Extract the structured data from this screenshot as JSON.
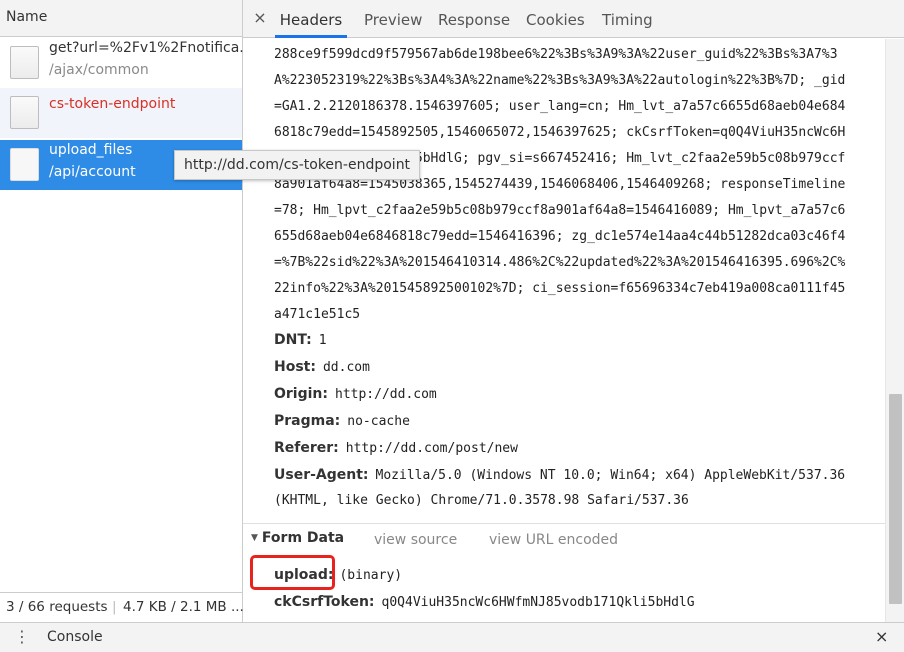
{
  "left": {
    "header": "Name",
    "requests": [
      {
        "name": "get?url=%2Fv1%2Fnotifica...",
        "path": "/ajax/common"
      },
      {
        "name": "cs-token-endpoint",
        "path": ""
      },
      {
        "name": "upload_files",
        "path": "/api/account"
      }
    ],
    "tooltip": "http://dd.com/cs-token-endpoint",
    "status": {
      "requests": "3 / 66 requests",
      "separator": "|",
      "size": "4.7 KB / 2.1 MB ..."
    }
  },
  "tabs": {
    "close": "×",
    "items": [
      "Headers",
      "Preview",
      "Response",
      "Cookies",
      "Timing"
    ],
    "active": "Headers"
  },
  "cookie_lines": [
    "288ce9f599dcd9f579567ab6de198bee6%22%3Bs%3A9%3A%22user_guid%22%3Bs%3A7%3",
    "A%223052319%22%3Bs%3A4%3A%22name%22%3Bs%3A9%3A%22autologin%22%3B%7D; _gid",
    "=GA1.2.2120186378.1546397605; user_lang=cn; Hm_lvt_a7a57c6655d68aeb04e684",
    "6818c79edd=1545892505,1546065072,1546397625; ckCsrfToken=q0Q4ViuH35ncWc6H",
    "WfmNJ85vodb171Qkli5bHdlG; pgv_si=s667452416; Hm_lvt_c2faa2e59b5c08b979ccf",
    "8a901af64a8=1545038365,1545274439,1546068406,1546409268; responseTimeline",
    "=78; Hm_lpvt_c2faa2e59b5c08b979ccf8a901af64a8=1546416089; Hm_lpvt_a7a57c6",
    "655d68aeb04e6846818c79edd=1546416396; zg_dc1e574e14aa4c44b51282dca03c46f4",
    "=%7B%22sid%22%3A%201546410314.486%2C%22updated%22%3A%201546416395.696%2C%",
    "22info%22%3A%201545892500102%7D; ci_session=f65696334c7eb419a008ca0111f45",
    "a471c1e51c5"
  ],
  "headers": {
    "dnt": {
      "key": "DNT:",
      "value": "1"
    },
    "host": {
      "key": "Host:",
      "value": "dd.com"
    },
    "origin": {
      "key": "Origin:",
      "value": "http://dd.com"
    },
    "pragma": {
      "key": "Pragma:",
      "value": "no-cache"
    },
    "referer": {
      "key": "Referer:",
      "value": "http://dd.com/post/new"
    },
    "user_agent": {
      "key": "User-Agent:",
      "value": "Mozilla/5.0 (Windows NT 10.0; Win64; x64) AppleWebKit/537.36",
      "value2": "(KHTML, like Gecko) Chrome/71.0.3578.98 Safari/537.36"
    }
  },
  "form_data": {
    "title": "Form Data",
    "view_source": "view source",
    "view_url_encoded": "view URL encoded",
    "upload": {
      "key": "upload:",
      "value": "(binary)"
    },
    "csrf": {
      "key": "ckCsrfToken:",
      "value": "q0Q4ViuH35ncWc6HWfmNJ85vodb171Qkli5bHdlG"
    }
  },
  "drawer": {
    "menu": "⋮",
    "console": "Console",
    "close": "×"
  },
  "colors": {
    "selected_row": "#2f8ce6",
    "error_text": "#d93025",
    "active_tab_underline": "#1a73e8",
    "highlight_box": "#e8231f"
  }
}
